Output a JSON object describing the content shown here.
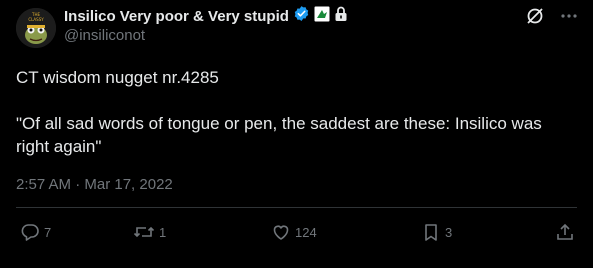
{
  "author": {
    "name_logo": "Insilico",
    "name_suffix": "Very poor & Very stupid",
    "handle": "@insiliconot",
    "avatar": "frog-avatar",
    "badges": [
      "verified-badge-icon",
      "affiliate-badge-icon",
      "lock-icon"
    ]
  },
  "tweet": {
    "line1": "CT wisdom nugget nr.4285",
    "line2": "\"Of all sad words of tongue or pen, the saddest are these: Insilico was right again\"",
    "timestamp": "2:57 AM · Mar 17, 2022"
  },
  "actions": {
    "replies": "7",
    "retweets": "1",
    "likes": "124",
    "bookmarks": "3"
  },
  "colors": {
    "background": "#000000",
    "text": "#e7e9ea",
    "muted": "#71767b",
    "verified": "#1d9bf0",
    "divider": "#2f3336"
  }
}
